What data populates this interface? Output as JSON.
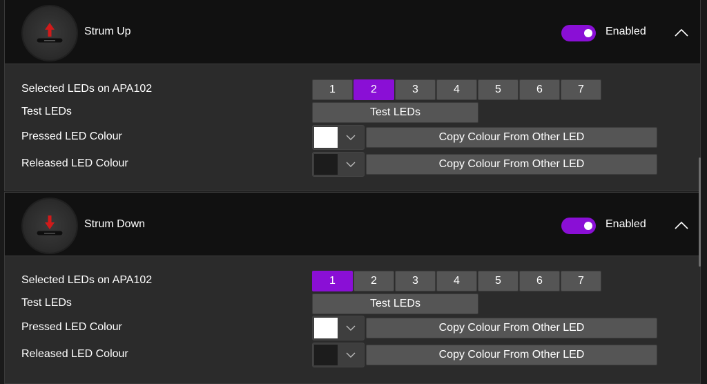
{
  "panels": [
    {
      "title": "Strum Up",
      "enabled_label": "Enabled",
      "enabled": true,
      "icon": "arrow-up-icon",
      "rows": {
        "selected_leds_label": "Selected LEDs on APA102",
        "test_leds_label": "Test LEDs",
        "pressed_label": "Pressed LED Colour",
        "released_label": "Released LED Colour"
      },
      "led_buttons": [
        "1",
        "2",
        "3",
        "4",
        "5",
        "6",
        "7"
      ],
      "active_led": "2",
      "test_button": "Test LEDs",
      "pressed_color": "#ffffff",
      "released_color": "#1c1c1c",
      "copy_pressed": "Copy Colour From Other LED",
      "copy_released": "Copy Colour From Other LED"
    },
    {
      "title": "Strum Down",
      "enabled_label": "Enabled",
      "enabled": true,
      "icon": "arrow-down-icon",
      "rows": {
        "selected_leds_label": "Selected LEDs on APA102",
        "test_leds_label": "Test LEDs",
        "pressed_label": "Pressed LED Colour",
        "released_label": "Released LED Colour"
      },
      "led_buttons": [
        "1",
        "2",
        "3",
        "4",
        "5",
        "6",
        "7"
      ],
      "active_led": "1",
      "test_button": "Test LEDs",
      "pressed_color": "#ffffff",
      "released_color": "#1c1c1c",
      "copy_pressed": "Copy Colour From Other LED",
      "copy_released": "Copy Colour From Other LED"
    }
  ],
  "colors": {
    "accent": "#8a0fd6",
    "icon_red": "#d11a1a",
    "button": "#555555",
    "panel_bg": "#2b2b2b",
    "header_bg": "#111111"
  }
}
